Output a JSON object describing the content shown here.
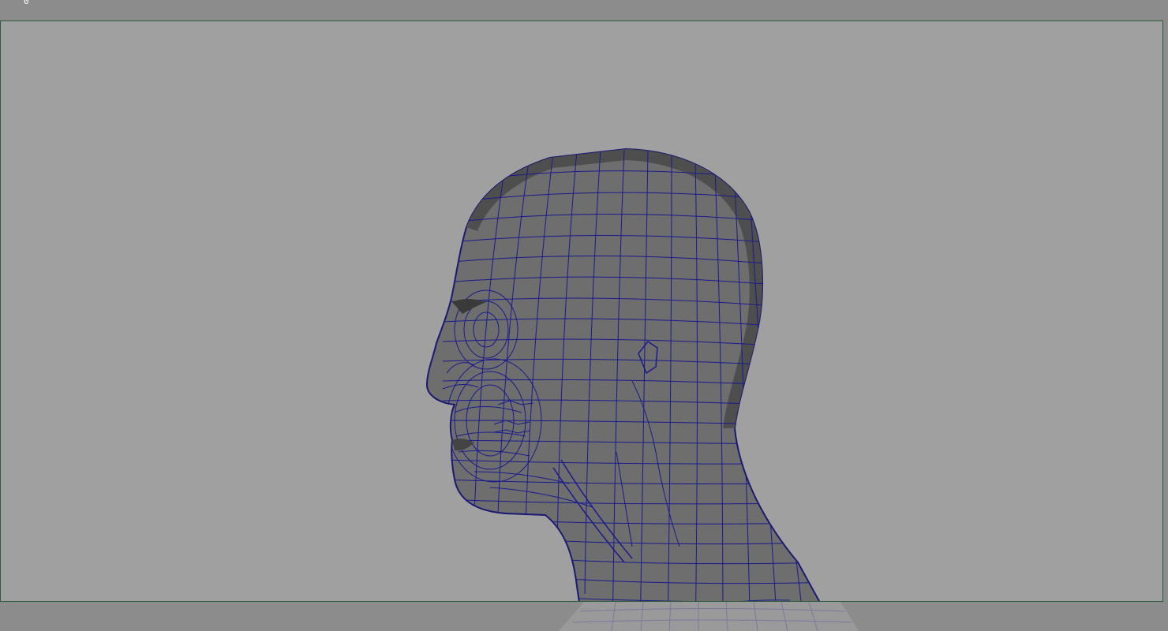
{
  "viewport": {
    "corner_marker": "0",
    "background_color": "#a0a0a0",
    "outside_gate_color": "#8c8c8c",
    "frame_border_color": "#2d5a3a",
    "wireframe_color": "#1a1a8c",
    "mesh_shade_color": "#6e6e6e",
    "object": "head-mesh"
  }
}
